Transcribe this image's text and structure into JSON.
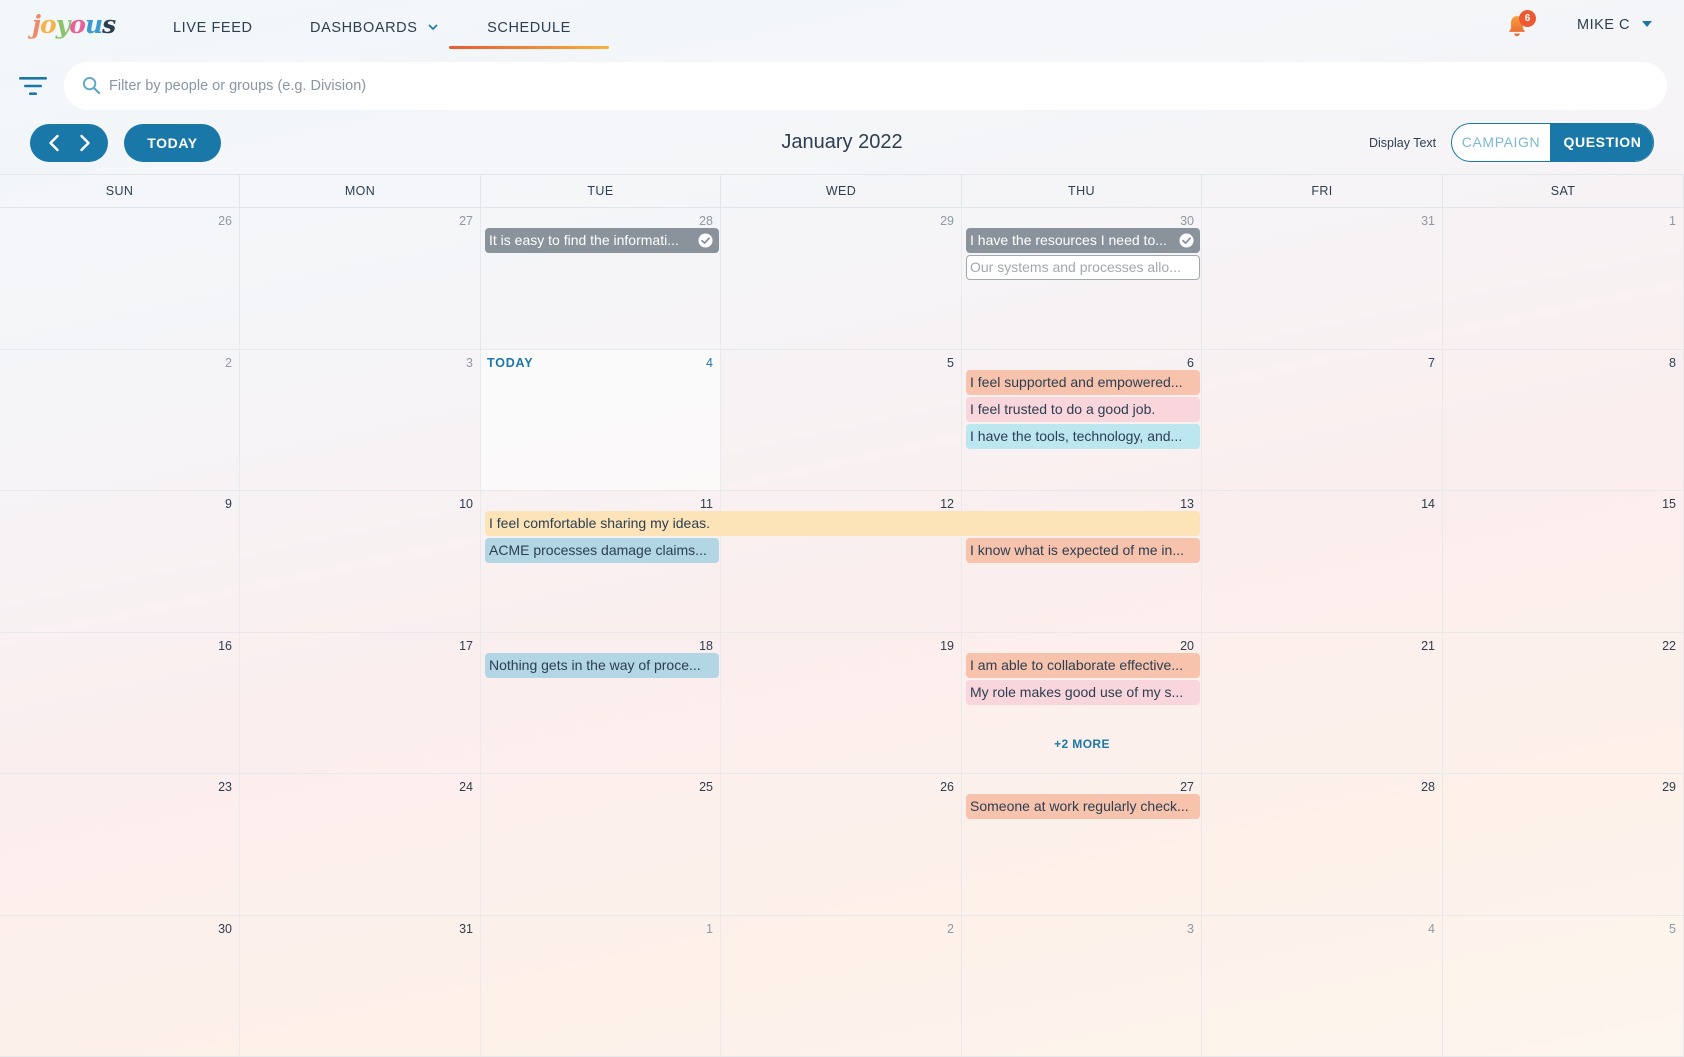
{
  "app": {
    "logo": "joyous",
    "nav": {
      "live_feed": "LIVE FEED",
      "dashboards": "DASHBOARDS",
      "schedule": "SCHEDULE"
    },
    "notifications_count": "6",
    "user_name": "MIKE C"
  },
  "filter": {
    "placeholder": "Filter by people or groups (e.g. Division)"
  },
  "toolbar": {
    "today_label": "TODAY",
    "month_title": "January 2022",
    "display_text_label": "Display Text",
    "toggle_campaign": "CAMPAIGN",
    "toggle_question": "QUESTION",
    "active_toggle": "QUESTION"
  },
  "calendar": {
    "weekdays": [
      "SUN",
      "MON",
      "TUE",
      "WED",
      "THU",
      "FRI",
      "SAT"
    ],
    "today_label": "TODAY",
    "weeks": [
      [
        {
          "d": "26",
          "other": true
        },
        {
          "d": "27",
          "other": true
        },
        {
          "d": "28",
          "other": true
        },
        {
          "d": "29",
          "other": true
        },
        {
          "d": "30",
          "other": true
        },
        {
          "d": "31",
          "other": true
        },
        {
          "d": "1",
          "other": true
        }
      ],
      [
        {
          "d": "2",
          "other": true
        },
        {
          "d": "3",
          "other": true
        },
        {
          "d": "4",
          "today": true
        },
        {
          "d": "5"
        },
        {
          "d": "6"
        },
        {
          "d": "7"
        },
        {
          "d": "8"
        }
      ],
      [
        {
          "d": "9"
        },
        {
          "d": "10"
        },
        {
          "d": "11"
        },
        {
          "d": "12"
        },
        {
          "d": "13"
        },
        {
          "d": "14"
        },
        {
          "d": "15"
        }
      ],
      [
        {
          "d": "16"
        },
        {
          "d": "17"
        },
        {
          "d": "18"
        },
        {
          "d": "19"
        },
        {
          "d": "20"
        },
        {
          "d": "21"
        },
        {
          "d": "22"
        }
      ],
      [
        {
          "d": "23"
        },
        {
          "d": "24"
        },
        {
          "d": "25"
        },
        {
          "d": "26"
        },
        {
          "d": "27"
        },
        {
          "d": "28"
        },
        {
          "d": "29"
        }
      ],
      [
        {
          "d": "30"
        },
        {
          "d": "31"
        },
        {
          "d": "1",
          "other": true
        },
        {
          "d": "2",
          "other": true
        },
        {
          "d": "3",
          "other": true
        },
        {
          "d": "4",
          "other": true
        },
        {
          "d": "5",
          "other": true
        }
      ]
    ],
    "events": [
      {
        "text": "It is easy to find the informati...",
        "style": "gray",
        "completed": true,
        "week": 0,
        "day": 2,
        "span": 1,
        "slot": 0
      },
      {
        "text": "I have the resources I need to...",
        "style": "gray",
        "completed": true,
        "week": 0,
        "day": 4,
        "span": 1,
        "slot": 0
      },
      {
        "text": "Our systems and processes allo...",
        "style": "outline",
        "week": 0,
        "day": 4,
        "span": 1,
        "slot": 1
      },
      {
        "text": "I feel supported and empowered...",
        "style": "salmon",
        "week": 1,
        "day": 4,
        "span": 1,
        "slot": 0
      },
      {
        "text": "I feel trusted to do a good job.",
        "style": "pink",
        "week": 1,
        "day": 4,
        "span": 1,
        "slot": 1
      },
      {
        "text": "I have the tools, technology, and...",
        "style": "cyan",
        "week": 1,
        "day": 4,
        "span": 1,
        "slot": 2
      },
      {
        "text": "I feel comfortable sharing my ideas.",
        "style": "yellow",
        "week": 2,
        "day": 2,
        "span": 3,
        "slot": 0
      },
      {
        "text": "ACME processes damage claims...",
        "style": "blue",
        "week": 2,
        "day": 2,
        "span": 1,
        "slot": 1
      },
      {
        "text": "I know what is expected of me in...",
        "style": "salmon",
        "week": 2,
        "day": 4,
        "span": 1,
        "slot": 1
      },
      {
        "text": "Nothing gets in the way of proce...",
        "style": "blue",
        "week": 3,
        "day": 2,
        "span": 1,
        "slot": 0
      },
      {
        "text": "I am able to collaborate effective...",
        "style": "salmon",
        "week": 3,
        "day": 4,
        "span": 1,
        "slot": 0
      },
      {
        "text": "My role makes good use of my s...",
        "style": "pink",
        "week": 3,
        "day": 4,
        "span": 1,
        "slot": 1
      },
      {
        "text": "Someone at work regularly check...",
        "style": "salmon",
        "week": 4,
        "day": 4,
        "span": 1,
        "slot": 0
      }
    ],
    "more_links": [
      {
        "text": "+2 MORE",
        "week": 3,
        "day": 4
      }
    ]
  }
}
